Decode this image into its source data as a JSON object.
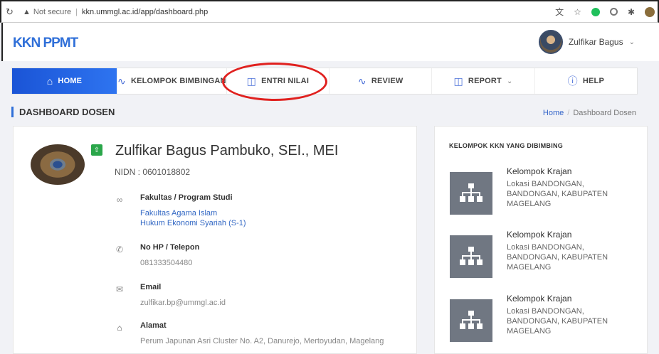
{
  "browser": {
    "reload_icon": "reload-icon",
    "security_label": "Not secure",
    "url": "kkn.ummgl.ac.id/app/dashboard.php",
    "toolbar_icons": [
      "translate-icon",
      "star-icon",
      "extension-green-icon",
      "extension-ring-icon",
      "puzzle-icon",
      "profile-avatar-icon"
    ]
  },
  "header": {
    "logo": "KKN PPMT",
    "user_name": "Zulfikar Bagus",
    "accent_color": "#2f6fd8"
  },
  "nav": {
    "items": [
      {
        "label": "HOME",
        "icon": "home-icon",
        "active": true
      },
      {
        "label": "KELOMPOK BIMBINGAN",
        "icon": "pulse-icon"
      },
      {
        "label": "ENTRI NILAI",
        "icon": "book-icon"
      },
      {
        "label": "REVIEW",
        "icon": "pulse-icon"
      },
      {
        "label": "REPORT",
        "icon": "book-icon",
        "has_dropdown": true
      },
      {
        "label": "HELP",
        "icon": "info-icon"
      }
    ],
    "annotation_color": "#e0211f"
  },
  "page": {
    "title": "DASHBOARD DOSEN",
    "breadcrumb": [
      "Home",
      "Dashboard Dosen"
    ]
  },
  "profile": {
    "name": "Zulfikar Bagus Pambuko, SEI., MEI",
    "nidn": "NIDN : 0601018802",
    "faculty_label": "Fakultas / Program Studi",
    "faculty": "Fakultas Agama Islam",
    "program": "Hukum Ekonomi Syariah (S-1)",
    "phone_label": "No HP / Telepon",
    "phone": "081333504480",
    "email_label": "Email",
    "email": "zulfikar.bp@ummgl.ac.id",
    "address_label": "Alamat",
    "address": "Perum Japunan Asri Cluster No. A2, Danurejo, Mertoyudan, Magelang"
  },
  "groups": {
    "heading": "KELOMPOK KKN YANG DIBIMBING",
    "items": [
      {
        "name": "Kelompok Krajan",
        "location": "Lokasi BANDONGAN, BANDONGAN, KABUPATEN MAGELANG"
      },
      {
        "name": "Kelompok Krajan",
        "location": "Lokasi BANDONGAN, BANDONGAN, KABUPATEN MAGELANG"
      },
      {
        "name": "Kelompok Krajan",
        "location": "Lokasi BANDONGAN, BANDONGAN, KABUPATEN MAGELANG"
      }
    ]
  }
}
